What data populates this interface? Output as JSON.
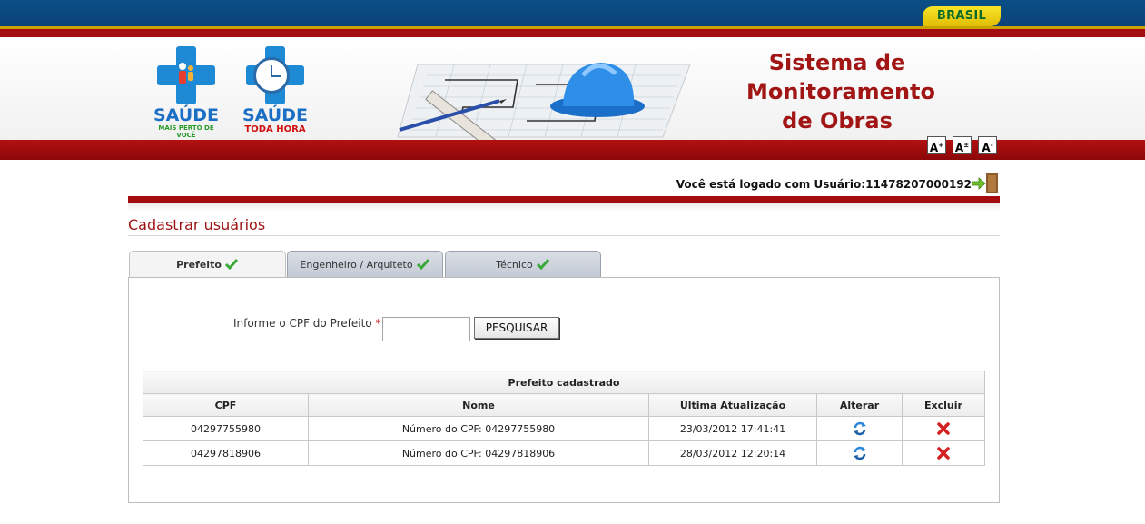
{
  "gov_bar": {
    "brasil_label": "BRASIL"
  },
  "header": {
    "logo1": {
      "name": "SAÚDE",
      "sub": "MAIS PERTO DE VOCÊ"
    },
    "logo2": {
      "name": "SAÚDE",
      "sub": "TODA HORA"
    },
    "system_title_line1": "Sistema de",
    "system_title_line2": "Monitoramento",
    "system_title_line3": "de Obras",
    "font_controls": [
      {
        "label": "A",
        "mod": "+"
      },
      {
        "label": "A",
        "mod": "±"
      },
      {
        "label": "A",
        "mod": "-"
      }
    ]
  },
  "user": {
    "logged_text": "Você está logado com Usuário:11478207000192"
  },
  "page": {
    "title": "Cadastrar usuários"
  },
  "tabs": [
    {
      "label": "Prefeito",
      "active": true
    },
    {
      "label": "Engenheiro / Arquiteto",
      "active": false
    },
    {
      "label": "Técnico",
      "active": false
    }
  ],
  "form": {
    "cpf_label": "Informe o CPF do Prefeito",
    "required_mark": "*",
    "cpf_value": "",
    "search_button": "PESQUISAR"
  },
  "table": {
    "caption": "Prefeito cadastrado",
    "columns": [
      "CPF",
      "Nome",
      "Última Atualização",
      "Alterar",
      "Excluir"
    ],
    "rows": [
      {
        "cpf": "04297755980",
        "nome": "Número do CPF: 04297755980",
        "atualizacao": "23/03/2012 17:41:41"
      },
      {
        "cpf": "04297818906",
        "nome": "Número do CPF: 04297818906",
        "atualizacao": "28/03/2012 12:20:14"
      }
    ]
  },
  "colors": {
    "gov_blue": "#0b4a80",
    "brand_red": "#a30d0d",
    "title_red": "#9c1111",
    "check_green": "#3aa83a",
    "delete_red": "#d42020"
  }
}
